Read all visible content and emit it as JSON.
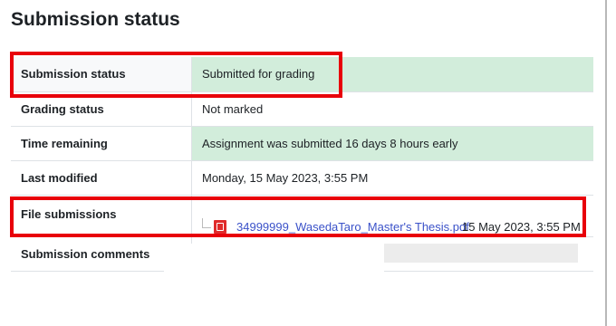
{
  "page": {
    "title": "Submission status"
  },
  "rows": {
    "submission_status": {
      "label": "Submission status",
      "value": "Submitted for grading"
    },
    "grading_status": {
      "label": "Grading status",
      "value": "Not marked"
    },
    "time_remaining": {
      "label": "Time remaining",
      "value": "Assignment was submitted 16 days 8 hours early"
    },
    "last_modified": {
      "label": "Last modified",
      "value": "Monday, 15 May 2023, 3:55 PM"
    },
    "file_submissions": {
      "label": "File submissions",
      "file_name": "34999999_WasedaTaro_Master's Thesis.pdf",
      "file_date": "15 May 2023, 3:55 PM",
      "icon": "pdf-file-icon"
    },
    "submission_comments": {
      "label": "Submission comments"
    }
  },
  "colors": {
    "success_bg": "#d2eddb",
    "highlight_border": "#e8000a",
    "link": "#3b52c9"
  }
}
